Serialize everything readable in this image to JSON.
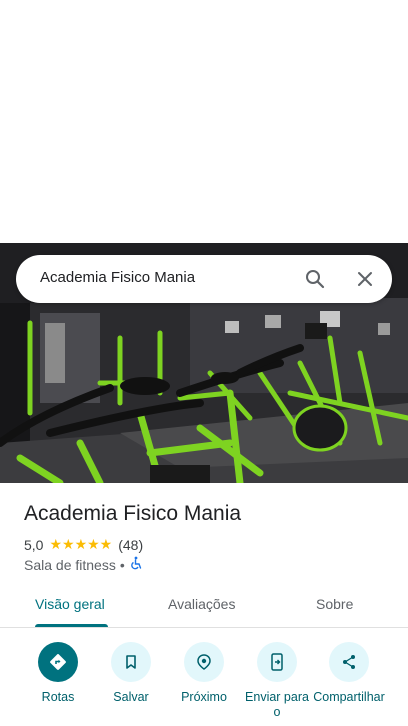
{
  "search": {
    "query": "Academia Fisico Mania"
  },
  "place": {
    "title": "Academia Fisico Mania",
    "rating": "5,0",
    "stars": "★★★★★",
    "review_count": "(48)",
    "category": "Sala de fitness",
    "separator": "•"
  },
  "tabs": [
    {
      "label": "Visão geral",
      "active": true
    },
    {
      "label": "Avaliações",
      "active": false
    },
    {
      "label": "Sobre",
      "active": false
    }
  ],
  "actions": [
    {
      "label": "Rotas",
      "icon": "directions-icon"
    },
    {
      "label": "Salvar",
      "icon": "bookmark-icon"
    },
    {
      "label": "Próximo",
      "icon": "nearby-icon"
    },
    {
      "label": "Enviar para o",
      "icon": "send-to-phone-icon"
    },
    {
      "label": "Compartilhar",
      "icon": "share-icon"
    }
  ],
  "colors": {
    "accent": "#00727f",
    "action_bg": "#e2f7fb",
    "star": "#fbbc04",
    "equipment_green": "#7ed321"
  }
}
